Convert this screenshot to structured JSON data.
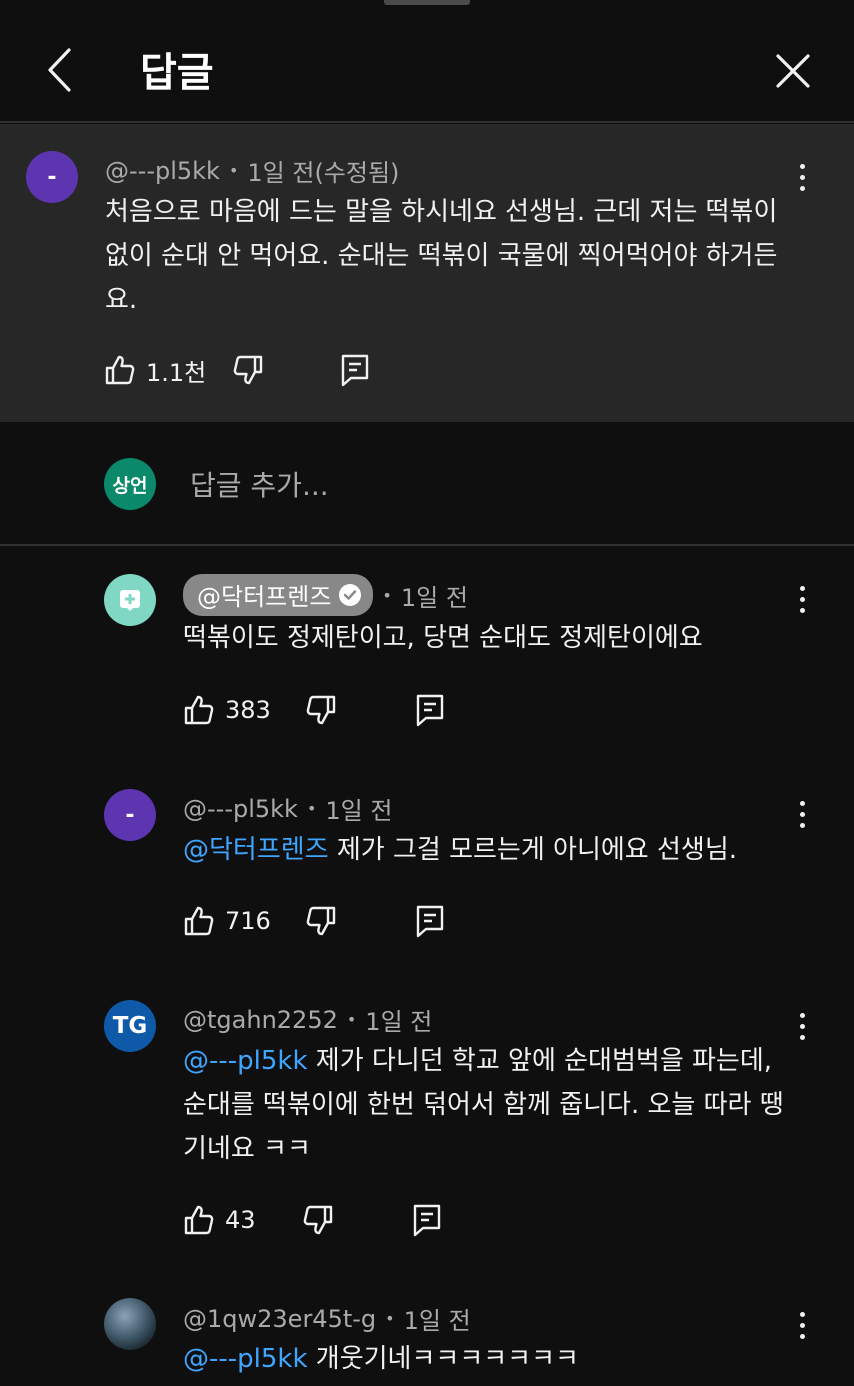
{
  "header": {
    "title": "답글",
    "back_icon": "chevron-left-icon",
    "close_icon": "close-icon"
  },
  "parent_comment": {
    "avatar_text": "-",
    "avatar_color": "#5e35b1",
    "author": "@---pl5kk",
    "time": "1일 전(수정됨)",
    "text": "처음으로 마음에 드는 말을 하시네요 선생님. 근데 저는 떡볶이 없이 순대 안 먹어요. 순대는 떡볶이 국물에 찍어먹어야 하거든요.",
    "likes": "1.1천"
  },
  "add_reply": {
    "avatar_text": "상언",
    "avatar_color": "#0b8a6b",
    "placeholder": "답글 추가..."
  },
  "replies": [
    {
      "avatar_text": "",
      "avatar_color": "#7fd7c4",
      "author": "@닥터프렌즈",
      "verified": true,
      "time": "1일 전",
      "mention": "",
      "text": "떡볶이도 정제탄이고, 당면 순대도 정제탄이에요",
      "likes": "383"
    },
    {
      "avatar_text": "-",
      "avatar_color": "#5e35b1",
      "author": "@---pl5kk",
      "verified": false,
      "time": "1일 전",
      "mention": "@닥터프렌즈",
      "text": " 제가 그걸 모르는게 아니에요 선생님.",
      "likes": "716"
    },
    {
      "avatar_text": "TG",
      "avatar_color": "#0e5aa8",
      "author": "@tgahn2252",
      "verified": false,
      "time": "1일 전",
      "mention": "@---pl5kk",
      "text": " 제가 다니던 학교 앞에 순대범벅을 파는데, 순대를 떡볶이에 한번 덖어서 함께 줍니다. 오늘 따라 땡기네요 ㅋㅋ",
      "likes": "43"
    },
    {
      "avatar_text": "",
      "avatar_color": "#4b6577",
      "author": "@1qw23er45t-g",
      "verified": false,
      "time": "1일 전",
      "mention": "@---pl5kk",
      "text": " 개웃기네ㅋㅋㅋㅋㅋㅋㅋ",
      "likes": ""
    }
  ]
}
